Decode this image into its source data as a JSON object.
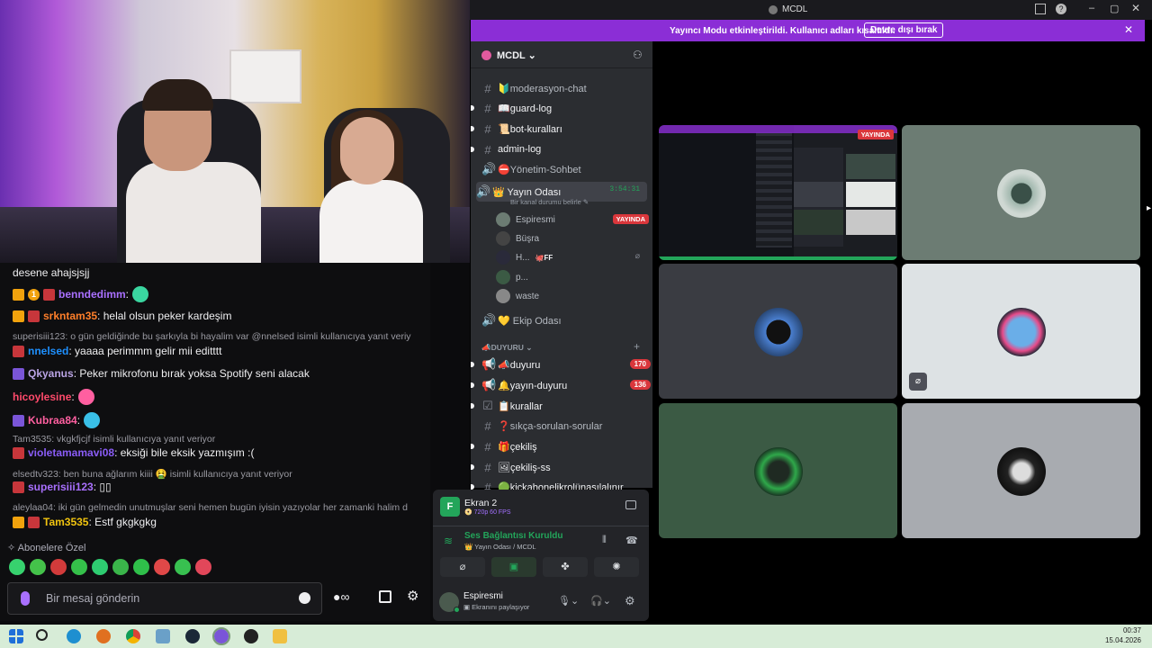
{
  "chat": {
    "messages": [
      {
        "type": "text",
        "text": "desene ahajsjsjj"
      },
      {
        "type": "msg",
        "user": "benndedimm",
        "sep": ":",
        "text": "",
        "color": "#a970ff"
      },
      {
        "type": "msg",
        "user": "srkntam35",
        "sep": ":",
        "text": " helal olsun peker kardeşim",
        "color": "#ff7f2a"
      },
      {
        "type": "reply",
        "text": "superisiii123: o gün geldiğinde bu şarkıyla bi hayalim var @nnelsed isimli kullanıcıya yanıt veriy"
      },
      {
        "type": "msg",
        "user": "nnelsed",
        "sep": ":",
        "text": " yaaaa perimmm gelir mii editttt",
        "color": "#1e90ff"
      },
      {
        "type": "msg",
        "user": "Qkyanus",
        "sep": ":",
        "text": " Peker mikrofonu bırak yoksa Spotify seni alacak",
        "color": "#b9a3e3"
      },
      {
        "type": "msg",
        "user": "hicoylesine",
        "sep": ":",
        "text": "",
        "color": "#ff4a6b"
      },
      {
        "type": "msg",
        "user": "Kubraa84",
        "sep": ":",
        "text": "",
        "color": "#ff5fa0"
      },
      {
        "type": "reply",
        "text": "Tam3535: vkgkfjcjf isimli kullanıcıya yanıt veriyor"
      },
      {
        "type": "msg",
        "user": "violetamamavi08",
        "sep": ":",
        "text": " eksiği bile eksik yazmışım :(",
        "color": "#8a5cf6"
      },
      {
        "type": "reply",
        "text": "elsedtv323: ben buna ağlarım kiiii 🤮 isimli kullanıcıya yanıt veriyor"
      },
      {
        "type": "msg",
        "user": "superisiii123",
        "sep": ":",
        "text": " ▯▯",
        "color": "#a970ff"
      },
      {
        "type": "reply",
        "text": "aleylaa04: iki gün gelmedin unutmuşlar seni hemen bugün iyisin yazıyolar her zamanki halim d"
      },
      {
        "type": "msg",
        "user": "Tam3535",
        "sep": ":",
        "text": " Estf gkgkgkg",
        "color": "#f1c40f"
      }
    ],
    "subs_label": "Abonelere Özel",
    "input_placeholder": "Bir mesaj gönderin",
    "emote_colors": [
      "#37d26e",
      "#44c24a",
      "#d23b3b",
      "#35c04a",
      "#2ecc71",
      "#3ab54a",
      "#2fbf4a",
      "#e04848",
      "#38c050",
      "#e2475a"
    ]
  },
  "discord": {
    "window_title": "MCDL",
    "banner_text": "Yayıncı Modu etkinleştirildi. Kullanıcı adları kısaltıldı.",
    "banner_button": "Devre dışı bırak",
    "server_name": "MCDL",
    "channels": [
      {
        "icon": "#",
        "name": "🔰moderasyon-chat",
        "unread": false,
        "arrow": false
      },
      {
        "icon": "#",
        "name": "📖guard-log",
        "unread": true,
        "arrow": true
      },
      {
        "icon": "#",
        "name": "📜bot-kuralları",
        "unread": true,
        "arrow": true
      },
      {
        "icon": "#",
        "name": "admin-log",
        "unread": true,
        "arrow": true
      },
      {
        "icon": "🔊",
        "name": "⛔Yönetim-Sohbet",
        "unread": false,
        "arrow": false
      }
    ],
    "voice_channel": {
      "name": "👑 Yayın Odası",
      "timer": "3:54:31",
      "status": "Bir kanal durumu belirle ✎"
    },
    "voice_users": [
      {
        "name": "Espiresmi",
        "badge": "YAYINDA",
        "extra": ""
      },
      {
        "name": "Büşra",
        "badge": "",
        "extra": ""
      },
      {
        "name": "H...",
        "badge": "",
        "extra": "🐙FF"
      },
      {
        "name": "p...",
        "badge": "",
        "extra": ""
      },
      {
        "name": "waste",
        "badge": "",
        "extra": ""
      }
    ],
    "ekip": "💛 Ekip Odası",
    "category": "📣DUYURU",
    "channels2": [
      {
        "icon": "📢",
        "name": "📣duyuru",
        "count": "170"
      },
      {
        "icon": "📢",
        "name": "🔔yayın-duyuru",
        "count": "136"
      },
      {
        "icon": "☑",
        "name": "📋kurallar",
        "count": ""
      },
      {
        "icon": "#",
        "name": "❓sıkça-sorulan-sorular",
        "count": ""
      },
      {
        "icon": "#",
        "name": "🎁çekiliş",
        "count": ""
      },
      {
        "icon": "#",
        "name": "🖼çekiliş-ss",
        "count": ""
      },
      {
        "icon": "#",
        "name": "🟢kickabonelikrolünasılalınır",
        "count": ""
      }
    ],
    "stream": {
      "title": "Ekran 2",
      "sub": "📀 720p 60 FPS"
    },
    "voice_conn": {
      "title": "Ses Bağlantısı Kuruldu",
      "sub": "👑 Yayın Odası / MCDL"
    },
    "user": {
      "name": "Espiresmi",
      "status": "Ekranını paylaşıyor"
    },
    "live_badge": "YAYINDA"
  },
  "taskbar": {
    "time": "00:37",
    "date": "15.04.2026"
  }
}
